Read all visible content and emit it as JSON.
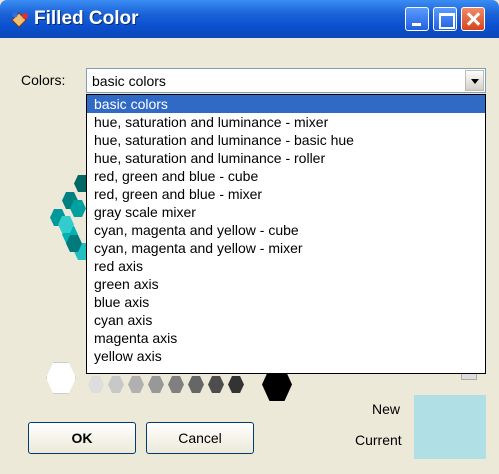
{
  "window": {
    "title": "Filled Color"
  },
  "colors_label": "Colors:",
  "combo": {
    "selected": "basic colors"
  },
  "dropdown_options": [
    "basic colors",
    "hue, saturation and luminance - mixer",
    "hue, saturation and luminance - basic hue",
    "hue, saturation and luminance - roller",
    "red, green and blue - cube",
    "red, green and blue - mixer",
    "gray scale mixer",
    "cyan, magenta and yellow - cube",
    "cyan, magenta and yellow - mixer",
    "red axis",
    "green axis",
    "blue axis",
    "cyan axis",
    "magenta axis",
    "yellow axis"
  ],
  "buttons": {
    "ok": "OK",
    "cancel": "Cancel"
  },
  "preview": {
    "new_label": "New",
    "current_label": "Current",
    "current_color": "#b0e0e6"
  },
  "colors": {
    "accent": "#316ac5",
    "titlebar": "#0a4fcf"
  }
}
